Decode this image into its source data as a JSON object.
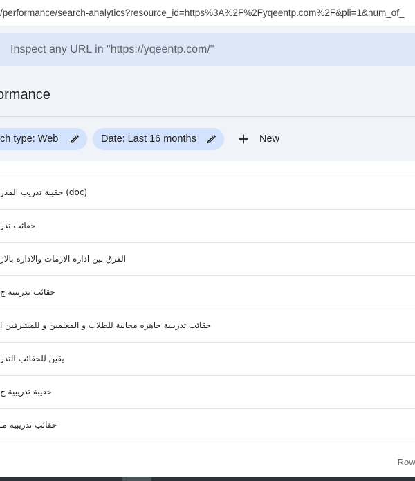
{
  "browser": {
    "url": "/performance/search-analytics?resource_id=https%3A%2F%2Fyqeentp.com%2F&pli=1&num_of_"
  },
  "inspect": {
    "placeholder": "Inspect any URL in \"https://yqeentp.com/\""
  },
  "header": {
    "title": "ormance"
  },
  "filters": {
    "search_type": "ch type: Web",
    "date": "Date: Last 16 months",
    "new_label": "New"
  },
  "table": {
    "rows": [
      "... ... ...",
      "حقيبة تدريب المدر (doc)",
      "حقائب تدر",
      "الفرق بين اداره الازمات والاداره بالاز",
      "حقائب تدريبية ج",
      "حقائب تدريبية جاهزه مجانية للطلاب و المعلمين و للمشرفين ا",
      "يقين للحقائب التدر",
      "حقيبة تدريبية ج",
      "حقائب تدريبية مـ"
    ],
    "footer": "Rows p"
  },
  "icons": {
    "edit": "pencil-icon",
    "add": "plus-icon"
  },
  "colors": {
    "chip_bg": "#d3e3fd",
    "header_bg": "#f0f4f9",
    "inspect_bg": "#dde7f7"
  }
}
